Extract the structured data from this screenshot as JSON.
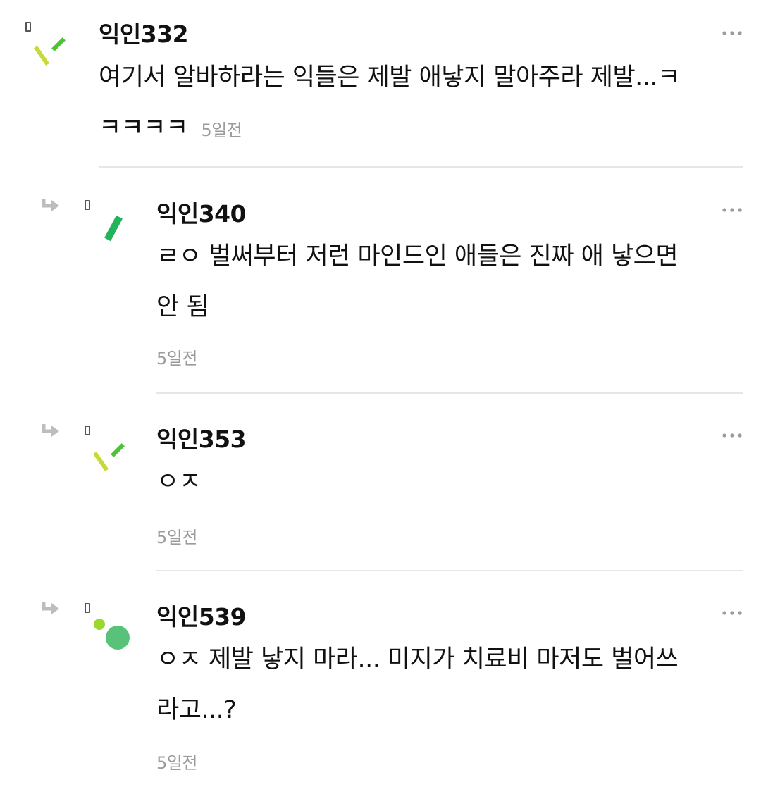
{
  "comments": [
    {
      "nickname": "익인332",
      "text": "여기서 알바하라는 익들은 제발 애낳지 말아주라 제발...ㅋ",
      "text_line2": "ㅋㅋㅋㅋ",
      "time": "5일전"
    },
    {
      "nickname": "익인340",
      "text_line1": "ㄹㅇ 벌써부터 저런 마인드인 애들은 진짜 애 낳으면",
      "text_line2": "안 됨",
      "time": "5일전"
    },
    {
      "nickname": "익인353",
      "text_line1": "ㅇㅈ",
      "time": "5일전"
    },
    {
      "nickname": "익인539",
      "text_line1": "ㅇㅈ 제발 낳지 마라... 미지가 치료비 마저도 벌어쓰",
      "text_line2": "라고...?",
      "time": "5일전"
    }
  ],
  "icons": {
    "reply": "reply-arrow-icon",
    "more": "more-dots-icon",
    "tag": "bookmark-tag-icon"
  },
  "colors": {
    "time_gray": "#9b9b9b",
    "divider": "#e6e6e6",
    "avatar_yellow": "#c7d93a",
    "avatar_green": "#4cc234",
    "avatar_emerald": "#22b45a",
    "avatar_dot_lime": "#9ad82c",
    "avatar_circle": "#58c27a"
  }
}
